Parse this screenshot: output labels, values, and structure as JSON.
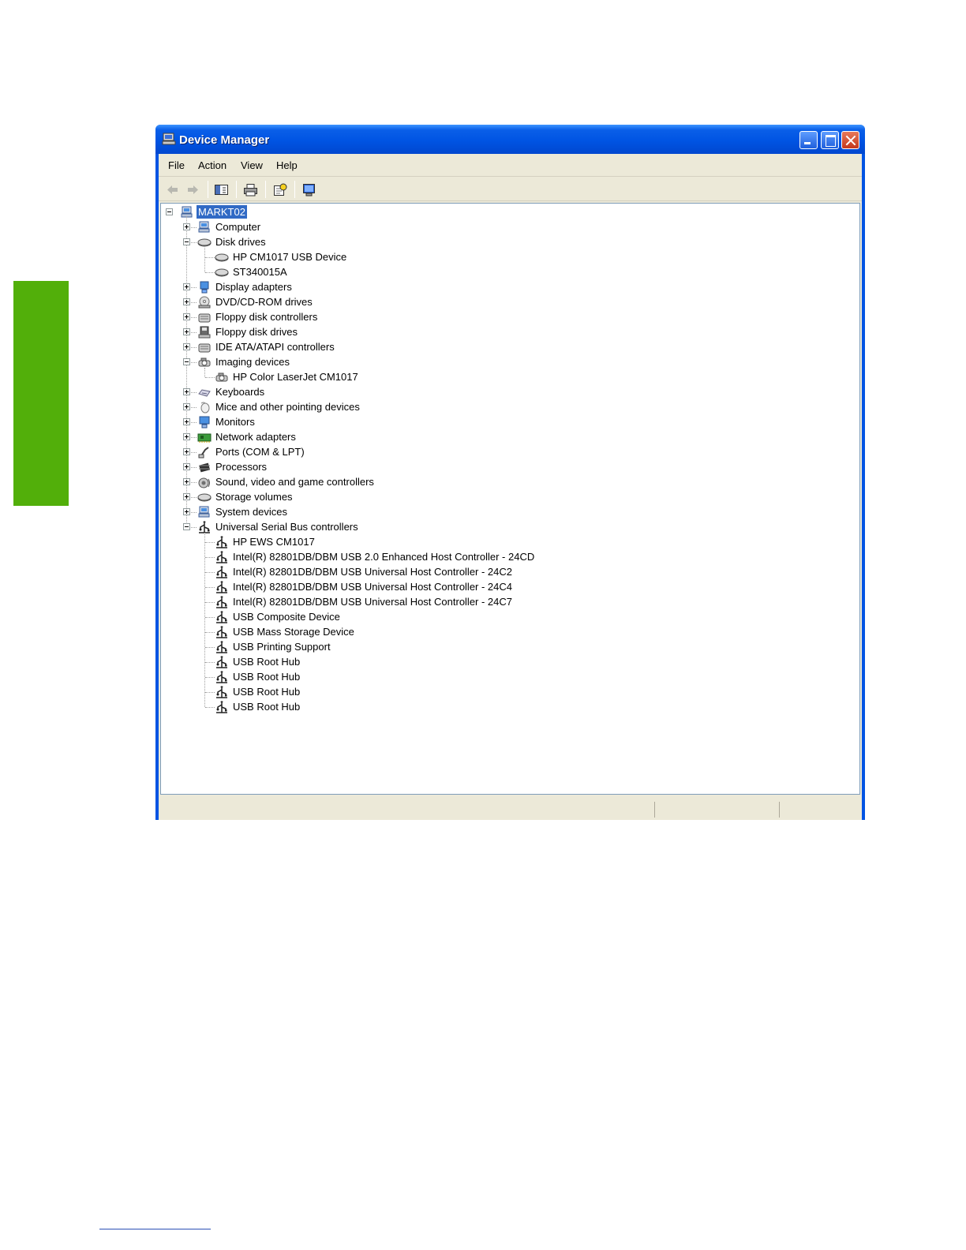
{
  "window": {
    "title": "Device Manager"
  },
  "menu": {
    "file": "File",
    "action": "Action",
    "view": "View",
    "help": "Help"
  },
  "toolbar": [
    "back-icon",
    "forward-icon",
    "show-hide-tree-icon",
    "print-icon",
    "properties-icon",
    "scan-hardware-icon"
  ],
  "tree": {
    "root": "MARKT02",
    "categories": [
      {
        "label": "Computer",
        "icon": "computer-icon",
        "expanded": false,
        "children": []
      },
      {
        "label": "Disk drives",
        "icon": "disk-drive-icon",
        "expanded": true,
        "children": [
          {
            "label": "HP CM1017 USB Device",
            "icon": "disk-drive-icon"
          },
          {
            "label": "ST340015A",
            "icon": "disk-drive-icon"
          }
        ]
      },
      {
        "label": "Display adapters",
        "icon": "display-adapter-icon",
        "expanded": false,
        "children": []
      },
      {
        "label": "DVD/CD-ROM drives",
        "icon": "cdrom-icon",
        "expanded": false,
        "children": []
      },
      {
        "label": "Floppy disk controllers",
        "icon": "controller-icon",
        "expanded": false,
        "children": []
      },
      {
        "label": "Floppy disk drives",
        "icon": "floppy-icon",
        "expanded": false,
        "children": []
      },
      {
        "label": "IDE ATA/ATAPI controllers",
        "icon": "controller-icon",
        "expanded": false,
        "children": []
      },
      {
        "label": "Imaging devices",
        "icon": "imaging-device-icon",
        "expanded": true,
        "children": [
          {
            "label": "HP Color LaserJet CM1017",
            "icon": "imaging-device-icon"
          }
        ]
      },
      {
        "label": "Keyboards",
        "icon": "keyboard-icon",
        "expanded": false,
        "children": []
      },
      {
        "label": "Mice and other pointing devices",
        "icon": "mouse-icon",
        "expanded": false,
        "children": []
      },
      {
        "label": "Monitors",
        "icon": "monitor-icon",
        "expanded": false,
        "children": []
      },
      {
        "label": "Network adapters",
        "icon": "network-adapter-icon",
        "expanded": false,
        "children": []
      },
      {
        "label": "Ports (COM & LPT)",
        "icon": "port-icon",
        "expanded": false,
        "children": []
      },
      {
        "label": "Processors",
        "icon": "processor-icon",
        "expanded": false,
        "children": []
      },
      {
        "label": "Sound, video and game controllers",
        "icon": "sound-icon",
        "expanded": false,
        "children": []
      },
      {
        "label": "Storage volumes",
        "icon": "disk-drive-icon",
        "expanded": false,
        "children": []
      },
      {
        "label": "System devices",
        "icon": "computer-icon",
        "expanded": false,
        "children": []
      },
      {
        "label": "Universal Serial Bus controllers",
        "icon": "usb-icon",
        "expanded": true,
        "children": [
          {
            "label": "HP EWS CM1017",
            "icon": "usb-icon"
          },
          {
            "label": "Intel(R) 82801DB/DBM USB 2.0 Enhanced Host Controller - 24CD",
            "icon": "usb-icon"
          },
          {
            "label": "Intel(R) 82801DB/DBM USB Universal Host Controller - 24C2",
            "icon": "usb-icon"
          },
          {
            "label": "Intel(R) 82801DB/DBM USB Universal Host Controller - 24C4",
            "icon": "usb-icon"
          },
          {
            "label": "Intel(R) 82801DB/DBM USB Universal Host Controller - 24C7",
            "icon": "usb-icon"
          },
          {
            "label": "USB Composite Device",
            "icon": "usb-icon"
          },
          {
            "label": "USB Mass Storage Device",
            "icon": "usb-icon"
          },
          {
            "label": "USB Printing Support",
            "icon": "usb-icon"
          },
          {
            "label": "USB Root Hub",
            "icon": "usb-icon"
          },
          {
            "label": "USB Root Hub",
            "icon": "usb-icon"
          },
          {
            "label": "USB Root Hub",
            "icon": "usb-icon"
          },
          {
            "label": "USB Root Hub",
            "icon": "usb-icon"
          }
        ]
      }
    ]
  },
  "colors": {
    "accent": "#52af0a",
    "titlebar": "#0054e3",
    "selection": "#316ac5"
  }
}
